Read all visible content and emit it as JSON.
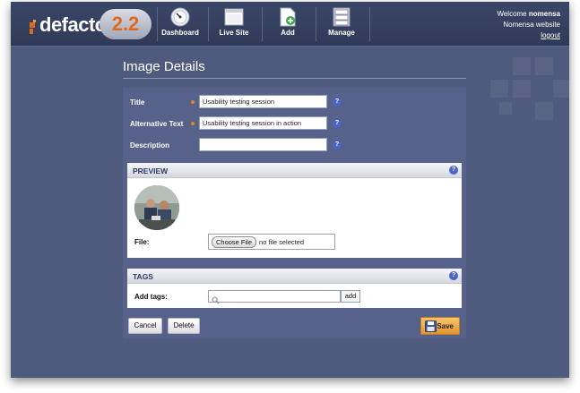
{
  "app": {
    "brand": "defacto",
    "version": "2.2"
  },
  "nav": {
    "items": [
      {
        "label": "Dashboard",
        "icon": "gauge-icon"
      },
      {
        "label": "Live Site",
        "icon": "window-icon"
      },
      {
        "label": "Add",
        "icon": "add-document-icon"
      },
      {
        "label": "Manage",
        "icon": "cabinet-icon"
      }
    ]
  },
  "user": {
    "welcome_prefix": "Welcome",
    "name": "nomensa",
    "site": "Nomensa website",
    "logout": "logout"
  },
  "page": {
    "title": "Image Details"
  },
  "form": {
    "title_label": "Title",
    "title_value": "Usability testing session",
    "alt_label": "Alternative Text",
    "alt_value": "Usability testing session in action",
    "desc_label": "Description",
    "desc_value": "",
    "help_glyph": "?"
  },
  "preview": {
    "heading": "PREVIEW",
    "file_label": "File:",
    "choose_button": "Choose File",
    "file_status": "no file selected"
  },
  "tags": {
    "heading": "TAGS",
    "add_tags_label": "Add tags:",
    "add_button": "add"
  },
  "actions": {
    "cancel": "Cancel",
    "delete": "Delete",
    "save": "Save"
  },
  "colors": {
    "background": "#4f5b7e",
    "header": "#2f3a58",
    "accent_orange": "#e6962e",
    "help_blue": "#4a64c8",
    "panel_heading": "#2d3866"
  }
}
